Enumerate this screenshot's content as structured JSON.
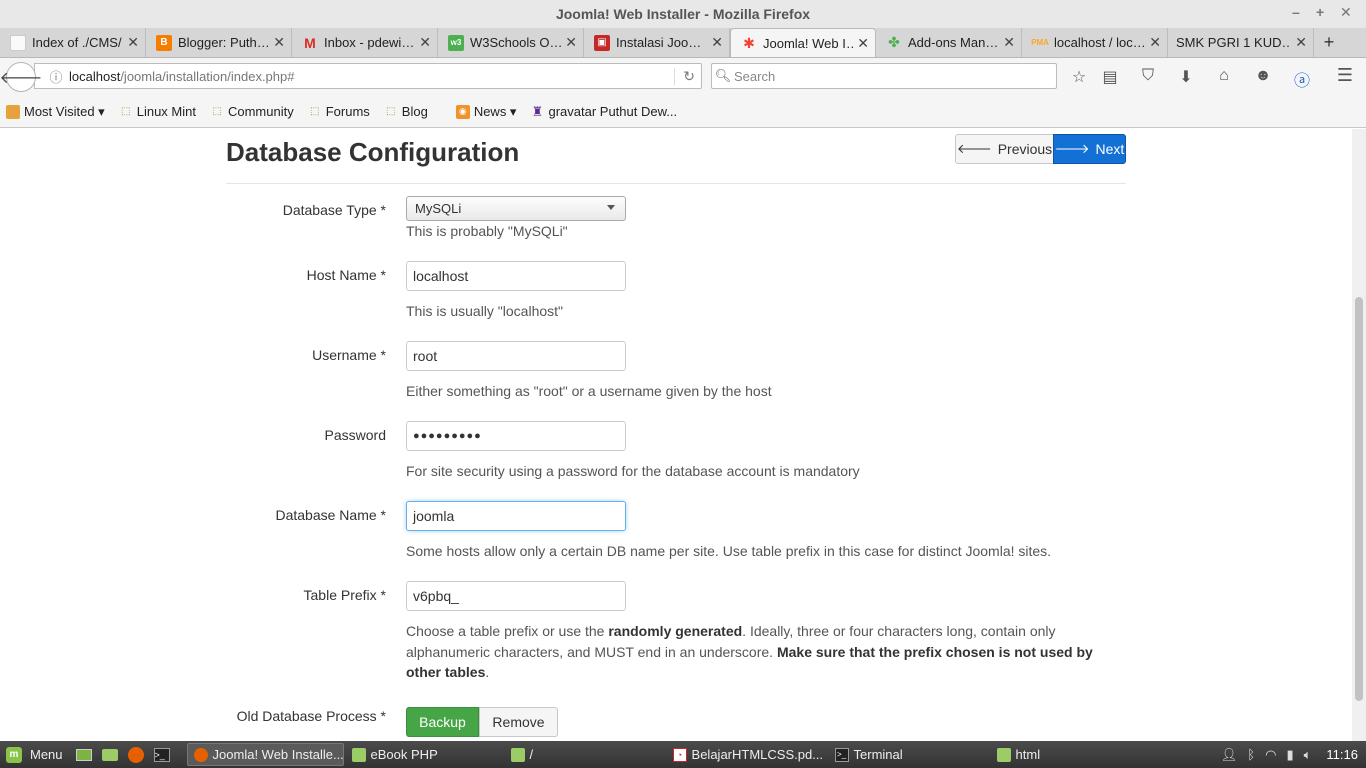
{
  "window": {
    "title": "Joomla! Web Installer - Mozilla Firefox",
    "ctl_min": "–",
    "ctl_max": "+",
    "ctl_close": "✕"
  },
  "tabs": [
    {
      "label": "Index of ./CMS/",
      "icon_color": "#f5f5f5"
    },
    {
      "label": "Blogger: Puth…",
      "icon_color": "#f57d00"
    },
    {
      "label": "Inbox - pdewi…",
      "icon_color": "#ffffff"
    },
    {
      "label": "W3Schools O…",
      "icon_color": "#4caf50"
    },
    {
      "label": "Instalasi Joo…",
      "icon_color": "#c62828"
    },
    {
      "label": "Joomla! Web I…",
      "icon_color": "#f5f5f5",
      "active": true
    },
    {
      "label": "Add-ons Man…",
      "icon_color": "#f5f5f5"
    },
    {
      "label": "localhost / loc…",
      "icon_color": "#f5f5f5"
    },
    {
      "label": "SMK PGRI 1 KUD…",
      "icon_color": "#f5f5f5"
    }
  ],
  "tab_close": "✕",
  "new_tab": "+",
  "nav": {
    "url_host": "localhost",
    "url_path": "/joomla/installation/index.php#",
    "search_placeholder": "Search"
  },
  "bookmarks": [
    {
      "label": "Most Visited ▾"
    },
    {
      "label": "Linux Mint"
    },
    {
      "label": "Community"
    },
    {
      "label": "Forums"
    },
    {
      "label": "Blog"
    },
    {
      "label": "News ▾"
    },
    {
      "label": "gravatar Puthut Dew..."
    }
  ],
  "page": {
    "title": "Database Configuration",
    "prev_label": "Previous",
    "next_label": "Next",
    "fields": {
      "db_type": {
        "label": "Database Type *",
        "value": "MySQLi",
        "help": "This is probably \"MySQLi\""
      },
      "host": {
        "label": "Host Name *",
        "value": "localhost",
        "help": "This is usually \"localhost\""
      },
      "username": {
        "label": "Username *",
        "value": "root",
        "help": "Either something as \"root\" or a username given by the host"
      },
      "password": {
        "label": "Password",
        "value": "●●●●●●●●●",
        "help": "For site security using a password for the database account is mandatory"
      },
      "db_name": {
        "label": "Database Name *",
        "value": "joomla",
        "help": "Some hosts allow only a certain DB name per site. Use table prefix in this case for distinct Joomla! sites."
      },
      "prefix": {
        "label": "Table Prefix *",
        "value": "v6pbq_",
        "help_1": "Choose a table prefix or use the ",
        "help_2": "randomly generated",
        "help_3": ". Ideally, three or four characters long, contain only alphanumeric characters, and MUST end in an underscore. ",
        "help_4": "Make sure that the prefix chosen is not used by other tables",
        "help_5": "."
      },
      "old_db": {
        "label": "Old Database Process *",
        "backup": "Backup",
        "remove": "Remove"
      }
    }
  },
  "taskbar": {
    "menu": "Menu",
    "windows": [
      {
        "label": "Joomla! Web Installe...",
        "active": true
      },
      {
        "label": "eBook PHP"
      },
      {
        "label": "/"
      },
      {
        "label": "BelajarHTMLCSS.pd..."
      },
      {
        "label": "Terminal"
      },
      {
        "label": "html"
      }
    ],
    "clock": "11:16"
  }
}
